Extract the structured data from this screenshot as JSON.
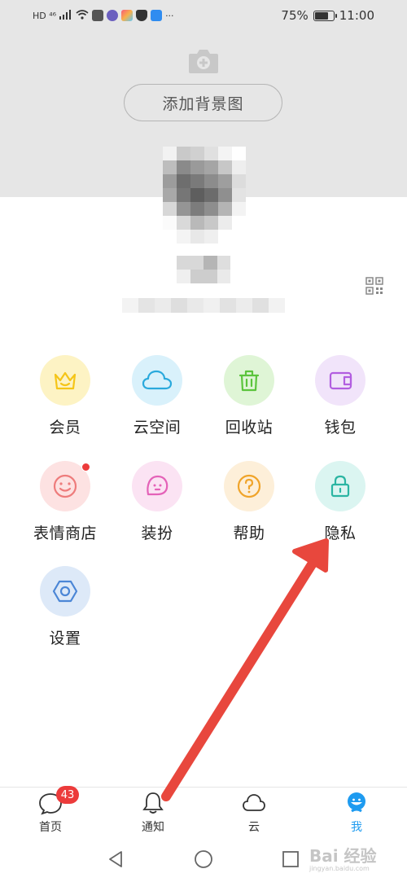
{
  "status_bar": {
    "left_text": "HD ⁴⁶",
    "battery": "75%",
    "battery_level": 0.75,
    "time": "11:00"
  },
  "header": {
    "add_background_label": "添加背景图"
  },
  "grid": [
    {
      "label": "会员",
      "icon": "crown-icon",
      "bg": "#fdf3c4",
      "color": "#f5c518"
    },
    {
      "label": "云空间",
      "icon": "cloud-icon",
      "bg": "#d9f1fb",
      "color": "#2aa9dc"
    },
    {
      "label": "回收站",
      "icon": "trash-icon",
      "bg": "#dff5d6",
      "color": "#5bc43c"
    },
    {
      "label": "钱包",
      "icon": "wallet-icon",
      "bg": "#f1e4fa",
      "color": "#b25ee0"
    },
    {
      "label": "表情商店",
      "icon": "smiley-icon",
      "bg": "#fde2e2",
      "color": "#ee7c7c",
      "dot": true
    },
    {
      "label": "装扮",
      "icon": "ghost-face-icon",
      "bg": "#fbe3f3",
      "color": "#e462b8"
    },
    {
      "label": "帮助",
      "icon": "help-icon",
      "bg": "#fdefd9",
      "color": "#f0a42a"
    },
    {
      "label": "隐私",
      "icon": "lock-icon",
      "bg": "#dbf5f1",
      "color": "#2bb5a2"
    },
    {
      "label": "设置",
      "icon": "hexagon-settings-icon",
      "bg": "#dde9f8",
      "color": "#4b86d6"
    }
  ],
  "bottom_nav": [
    {
      "label": "首页",
      "icon": "chat-bubble-icon",
      "badge": "43",
      "active": false
    },
    {
      "label": "通知",
      "icon": "bell-icon",
      "active": false
    },
    {
      "label": "云",
      "icon": "cloud-outline-icon",
      "active": false
    },
    {
      "label": "我",
      "icon": "profile-icon",
      "active": true
    }
  ],
  "watermark": {
    "main": "Bai 经验",
    "sub": "jingyan.baidu.com"
  },
  "colors": {
    "header_gray": "#e6e6e6",
    "active_blue": "#1e9bf0",
    "badge_red": "#ec3b3b",
    "arrow_red": "#e8473d"
  }
}
